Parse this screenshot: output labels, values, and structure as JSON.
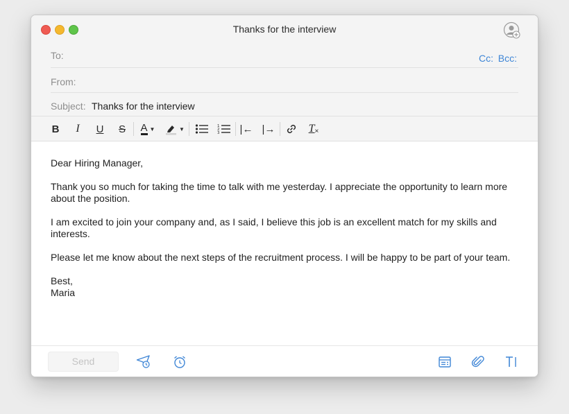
{
  "window": {
    "title": "Thanks for the interview"
  },
  "header": {
    "to_label": "To:",
    "to_value": "",
    "cc_label": "Cc:",
    "bcc_label": "Bcc:",
    "from_label": "From:",
    "from_value": "",
    "subject_label": "Subject:",
    "subject_value": "Thanks for the interview"
  },
  "toolbar": {
    "bold": "B",
    "italic": "I",
    "underline": "U",
    "strikethrough": "S",
    "text_color": "A",
    "outdent": "|←",
    "indent": "|→",
    "clear_format": "T"
  },
  "body": {
    "greeting": "Dear Hiring Manager,",
    "paragraph1": "Thank you so much for taking the time to talk with me yesterday. I appreciate the opportunity to learn more about the position.",
    "paragraph2": "I am excited to join your company and, as I said, I believe this job is an excellent match for my skills and interests.",
    "paragraph3": "Please let me know about the next steps of the recruitment process. I will be happy to be part of your team.",
    "closing": "Best,",
    "signature": "Maria"
  },
  "footer": {
    "send_label": "Send"
  },
  "colors": {
    "accent": "#3f86d6",
    "close": "#ef5b53",
    "minimize": "#f5b82e",
    "maximize": "#5fc54a"
  }
}
